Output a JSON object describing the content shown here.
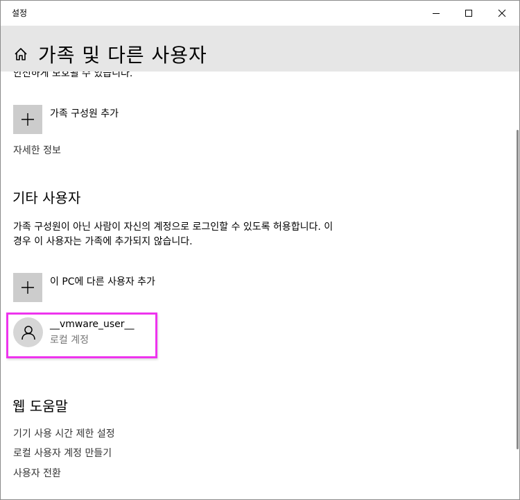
{
  "window": {
    "title": "설정",
    "minimize_icon": "minimize-icon",
    "maximize_icon": "maximize-icon",
    "close_icon": "close-icon"
  },
  "header": {
    "home_icon": "home-icon",
    "title": "가족 및 다른 사용자"
  },
  "family": {
    "cut_text": "안전하게 보호될 수 있습니다.",
    "add_label": "가족 구성원 추가",
    "add_icon": "plus-icon",
    "more_info": "자세한 정보"
  },
  "other_users": {
    "title": "기타 사용자",
    "description": "가족 구성원이 아닌 사람이 자신의 계정으로 로그인할 수 있도록 허용합니다. 이 경우 이 사용자는 가족에 추가되지 않습니다.",
    "add_label": "이 PC에 다른 사용자 추가",
    "add_icon": "plus-icon",
    "users": [
      {
        "name": "__vmware_user__",
        "type": "로컬 계정",
        "icon": "user-icon",
        "highlight_color": "#ee34ee"
      }
    ]
  },
  "web_help": {
    "title": "웹 도움말",
    "links": [
      "기기 사용 시간 제한 설정",
      "로컬 사용자 계정 만들기",
      "사용자 전환"
    ]
  }
}
